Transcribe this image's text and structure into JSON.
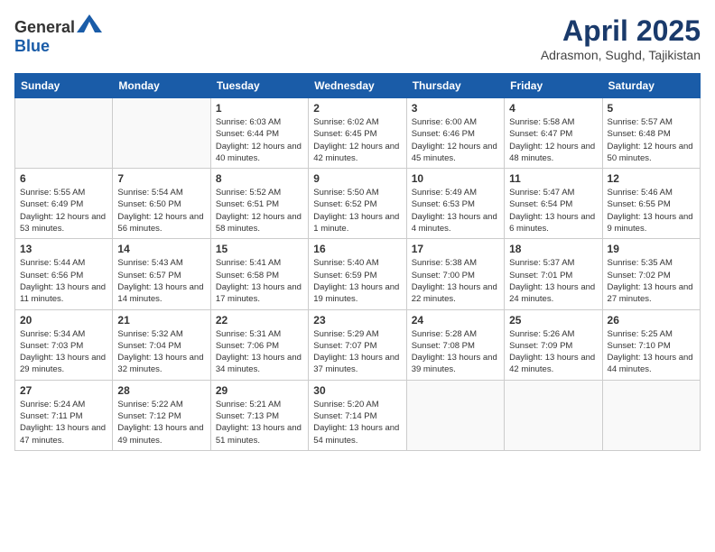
{
  "header": {
    "logo_general": "General",
    "logo_blue": "Blue",
    "title": "April 2025",
    "location": "Adrasmon, Sughd, Tajikistan"
  },
  "days_of_week": [
    "Sunday",
    "Monday",
    "Tuesday",
    "Wednesday",
    "Thursday",
    "Friday",
    "Saturday"
  ],
  "weeks": [
    [
      {
        "day": "",
        "info": ""
      },
      {
        "day": "",
        "info": ""
      },
      {
        "day": "1",
        "info": "Sunrise: 6:03 AM\nSunset: 6:44 PM\nDaylight: 12 hours and 40 minutes."
      },
      {
        "day": "2",
        "info": "Sunrise: 6:02 AM\nSunset: 6:45 PM\nDaylight: 12 hours and 42 minutes."
      },
      {
        "day": "3",
        "info": "Sunrise: 6:00 AM\nSunset: 6:46 PM\nDaylight: 12 hours and 45 minutes."
      },
      {
        "day": "4",
        "info": "Sunrise: 5:58 AM\nSunset: 6:47 PM\nDaylight: 12 hours and 48 minutes."
      },
      {
        "day": "5",
        "info": "Sunrise: 5:57 AM\nSunset: 6:48 PM\nDaylight: 12 hours and 50 minutes."
      }
    ],
    [
      {
        "day": "6",
        "info": "Sunrise: 5:55 AM\nSunset: 6:49 PM\nDaylight: 12 hours and 53 minutes."
      },
      {
        "day": "7",
        "info": "Sunrise: 5:54 AM\nSunset: 6:50 PM\nDaylight: 12 hours and 56 minutes."
      },
      {
        "day": "8",
        "info": "Sunrise: 5:52 AM\nSunset: 6:51 PM\nDaylight: 12 hours and 58 minutes."
      },
      {
        "day": "9",
        "info": "Sunrise: 5:50 AM\nSunset: 6:52 PM\nDaylight: 13 hours and 1 minute."
      },
      {
        "day": "10",
        "info": "Sunrise: 5:49 AM\nSunset: 6:53 PM\nDaylight: 13 hours and 4 minutes."
      },
      {
        "day": "11",
        "info": "Sunrise: 5:47 AM\nSunset: 6:54 PM\nDaylight: 13 hours and 6 minutes."
      },
      {
        "day": "12",
        "info": "Sunrise: 5:46 AM\nSunset: 6:55 PM\nDaylight: 13 hours and 9 minutes."
      }
    ],
    [
      {
        "day": "13",
        "info": "Sunrise: 5:44 AM\nSunset: 6:56 PM\nDaylight: 13 hours and 11 minutes."
      },
      {
        "day": "14",
        "info": "Sunrise: 5:43 AM\nSunset: 6:57 PM\nDaylight: 13 hours and 14 minutes."
      },
      {
        "day": "15",
        "info": "Sunrise: 5:41 AM\nSunset: 6:58 PM\nDaylight: 13 hours and 17 minutes."
      },
      {
        "day": "16",
        "info": "Sunrise: 5:40 AM\nSunset: 6:59 PM\nDaylight: 13 hours and 19 minutes."
      },
      {
        "day": "17",
        "info": "Sunrise: 5:38 AM\nSunset: 7:00 PM\nDaylight: 13 hours and 22 minutes."
      },
      {
        "day": "18",
        "info": "Sunrise: 5:37 AM\nSunset: 7:01 PM\nDaylight: 13 hours and 24 minutes."
      },
      {
        "day": "19",
        "info": "Sunrise: 5:35 AM\nSunset: 7:02 PM\nDaylight: 13 hours and 27 minutes."
      }
    ],
    [
      {
        "day": "20",
        "info": "Sunrise: 5:34 AM\nSunset: 7:03 PM\nDaylight: 13 hours and 29 minutes."
      },
      {
        "day": "21",
        "info": "Sunrise: 5:32 AM\nSunset: 7:04 PM\nDaylight: 13 hours and 32 minutes."
      },
      {
        "day": "22",
        "info": "Sunrise: 5:31 AM\nSunset: 7:06 PM\nDaylight: 13 hours and 34 minutes."
      },
      {
        "day": "23",
        "info": "Sunrise: 5:29 AM\nSunset: 7:07 PM\nDaylight: 13 hours and 37 minutes."
      },
      {
        "day": "24",
        "info": "Sunrise: 5:28 AM\nSunset: 7:08 PM\nDaylight: 13 hours and 39 minutes."
      },
      {
        "day": "25",
        "info": "Sunrise: 5:26 AM\nSunset: 7:09 PM\nDaylight: 13 hours and 42 minutes."
      },
      {
        "day": "26",
        "info": "Sunrise: 5:25 AM\nSunset: 7:10 PM\nDaylight: 13 hours and 44 minutes."
      }
    ],
    [
      {
        "day": "27",
        "info": "Sunrise: 5:24 AM\nSunset: 7:11 PM\nDaylight: 13 hours and 47 minutes."
      },
      {
        "day": "28",
        "info": "Sunrise: 5:22 AM\nSunset: 7:12 PM\nDaylight: 13 hours and 49 minutes."
      },
      {
        "day": "29",
        "info": "Sunrise: 5:21 AM\nSunset: 7:13 PM\nDaylight: 13 hours and 51 minutes."
      },
      {
        "day": "30",
        "info": "Sunrise: 5:20 AM\nSunset: 7:14 PM\nDaylight: 13 hours and 54 minutes."
      },
      {
        "day": "",
        "info": ""
      },
      {
        "day": "",
        "info": ""
      },
      {
        "day": "",
        "info": ""
      }
    ]
  ]
}
